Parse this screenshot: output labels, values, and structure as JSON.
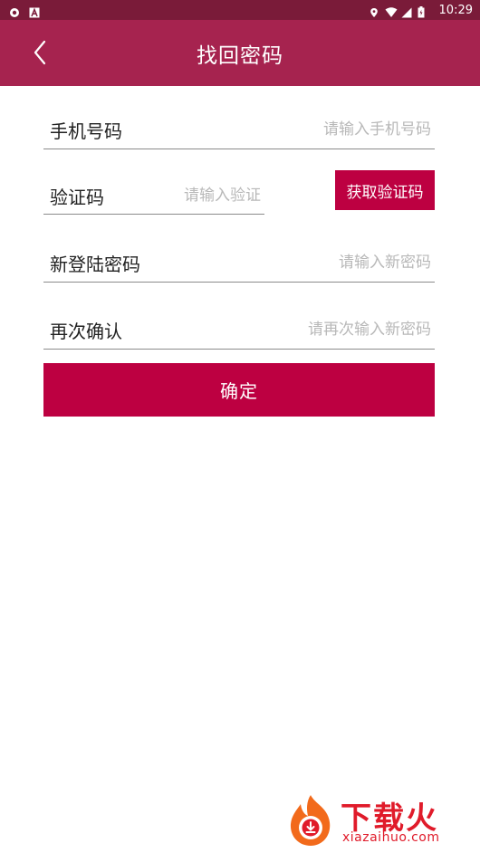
{
  "status_bar": {
    "time": "10:29",
    "icons": [
      "shield-icon",
      "a-icon",
      "location-icon",
      "wifi-icon",
      "signal-icon",
      "battery-icon"
    ]
  },
  "header": {
    "title": "找回密码",
    "back_icon": "chevron-left-icon"
  },
  "form": {
    "phone": {
      "label": "手机号码",
      "placeholder": "请输入手机号码",
      "value": ""
    },
    "code": {
      "label": "验证码",
      "placeholder": "请输入验证",
      "value": "",
      "button": "获取验证码"
    },
    "new_password": {
      "label": "新登陆密码",
      "placeholder": "请输入新密码",
      "value": ""
    },
    "confirm_password": {
      "label": "再次确认",
      "placeholder": "请再次输入新密码",
      "value": ""
    },
    "submit": "确定"
  },
  "watermark": {
    "title": "下载火",
    "subtitle": "xiazaihuo.com"
  },
  "colors": {
    "status_bar": "#7a1b39",
    "header": "#a6234f",
    "accent": "#bd0041",
    "watermark": "#e01b2a"
  }
}
